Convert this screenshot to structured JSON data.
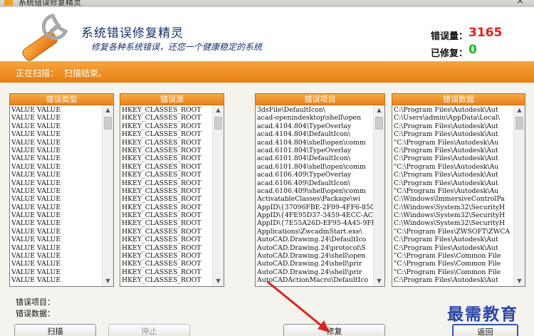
{
  "window": {
    "title": "系统错误修复精灵",
    "close_glyph": "×"
  },
  "header": {
    "title": "系统错误修复精灵",
    "subtitle": "修复各种系统错误，还您一个健康稳定的系统",
    "errors_label": "错误量：",
    "errors_value": "3165",
    "fixed_label": "已修复：",
    "fixed_value": "0",
    "errors_color": "#e8201a",
    "fixed_color": "#16b816"
  },
  "status": {
    "label": "正在扫描：",
    "value": "扫描结束。"
  },
  "panels": [
    {
      "header": "错误类型",
      "items": [
        "VALUE VALUE",
        "VALUE VALUE",
        "VALUE VALUE",
        "VALUE VALUE",
        "VALUE VALUE",
        "VALUE VALUE",
        "VALUE VALUE",
        "VALUE VALUE",
        "VALUE VALUE",
        "VALUE VALUE",
        "VALUE VALUE",
        "VALUE VALUE",
        "VALUE VALUE",
        "VALUE VALUE",
        "VALUE VALUE",
        "VALUE VALUE",
        "VALUE VALUE",
        "VALUE VALUE",
        "VALUE VALUE",
        "VALUE VALUE",
        "VALUE VALUE",
        "VALUE VALUE"
      ]
    },
    {
      "header": "错误源",
      "items": [
        "HKEY_CLASSES_ROOT",
        "HKEY_CLASSES_ROOT",
        "HKEY_CLASSES_ROOT",
        "HKEY_CLASSES_ROOT",
        "HKEY_CLASSES_ROOT",
        "HKEY_CLASSES_ROOT",
        "HKEY_CLASSES_ROOT",
        "HKEY_CLASSES_ROOT",
        "HKEY_CLASSES_ROOT",
        "HKEY_CLASSES_ROOT",
        "HKEY_CLASSES_ROOT",
        "HKEY_CLASSES_ROOT",
        "HKEY_CLASSES_ROOT",
        "HKEY_CLASSES_ROOT",
        "HKEY_CLASSES_ROOT",
        "HKEY_CLASSES_ROOT",
        "HKEY_CLASSES_ROOT",
        "HKEY_CLASSES_ROOT",
        "HKEY_CLASSES_ROOT",
        "HKEY_CLASSES_ROOT",
        "HKEY_CLASSES_ROOT",
        "HKEY_CLASSES_ROOT"
      ]
    },
    {
      "header": "错误项目",
      "items": [
        "3dsFile\\DefaultIcon\\",
        "acad-openindesktop\\shell\\open",
        "acad.4104.804\\TypeOverlay",
        "acad.4104.804\\DefaultIcon\\",
        "acad.4104.804\\shell\\open\\comm",
        "acad.6101.804\\TypeOverlay",
        "acad.6101.804\\DefaultIcon\\",
        "acad.6101.804\\shell\\open\\comm",
        "acad.6106.409\\TypeOverlay",
        "acad.6106.409\\DefaultIcon\\",
        "acad.6106.409\\shell\\open\\comm",
        "ActivatableClasses\\Package\\wi",
        "AppID\\{37096FBE-2F09-4FF6-850",
        "AppID\\{4FE95D37-3459-4ECC-AC3",
        "AppID\\{7E55A26D-EF95-4A45-9FE",
        "Applications\\ZwcadmStart.exe\\",
        "AutoCAD.Drawing.24\\DefaultIco",
        "AutoCAD.Drawing.24\\protocol\\S",
        "AutoCAD.Drawing.24\\shell\\open",
        "AutoCAD.Drawing.24\\shell\\prir",
        "AutoCAD.Drawing.24\\shell\\prir",
        "AutoCADActionMacro\\DefaultIco"
      ]
    },
    {
      "header": "错误数据",
      "items": [
        "C:\\Program Files\\Autodesk\\Aut",
        "C:\\Users\\admin\\AppData\\Local\\",
        "C:\\Program Files\\Autodesk\\Aut",
        "C:\\Program Files\\Autodesk\\Aut",
        "\"C:\\Program Files\\Autodesk\\Au",
        "C:\\Program Files\\Autodesk\\Aut",
        "C:\\Program Files\\Autodesk\\Aut",
        "\"C:\\Program Files\\Autodesk\\Au",
        "C:\\Program Files\\Autodesk\\Aut",
        "C:\\Program Files\\Autodesk\\Aut",
        "\"C:\\Program Files\\Autodesk\\Au",
        "C:\\Windows\\ImmersiveControlPa",
        "C:\\Windows\\System32\\SecurityH",
        "C:\\Windows\\System32\\SecurityH",
        "C:\\Windows\\System32\\SecurityH",
        "\"C:\\Program Files\\ZWSOFT\\ZWCA",
        "C:\\Program Files\\Autodesk\\Aut",
        "C:\\Program Files\\Autodesk\\Aut",
        "\"C:\\Program Files\\Common File",
        "\"C:\\Program Files\\Common File",
        "\"C:\\Program Files\\Common File",
        "C:\\Program Files\\Autodesk\\Aut"
      ]
    }
  ],
  "details": {
    "item_label": "错误项目：",
    "data_label": "错误数据："
  },
  "buttons": {
    "scan": "扫描",
    "stop": "停止",
    "repair": "修复",
    "back": "返回"
  },
  "scroll": {
    "up": "▲",
    "down": "▼"
  },
  "watermark": "最需教育",
  "colors": {
    "accent_orange": "#ee8a1f",
    "annotation_arrow": "#d9231d"
  }
}
